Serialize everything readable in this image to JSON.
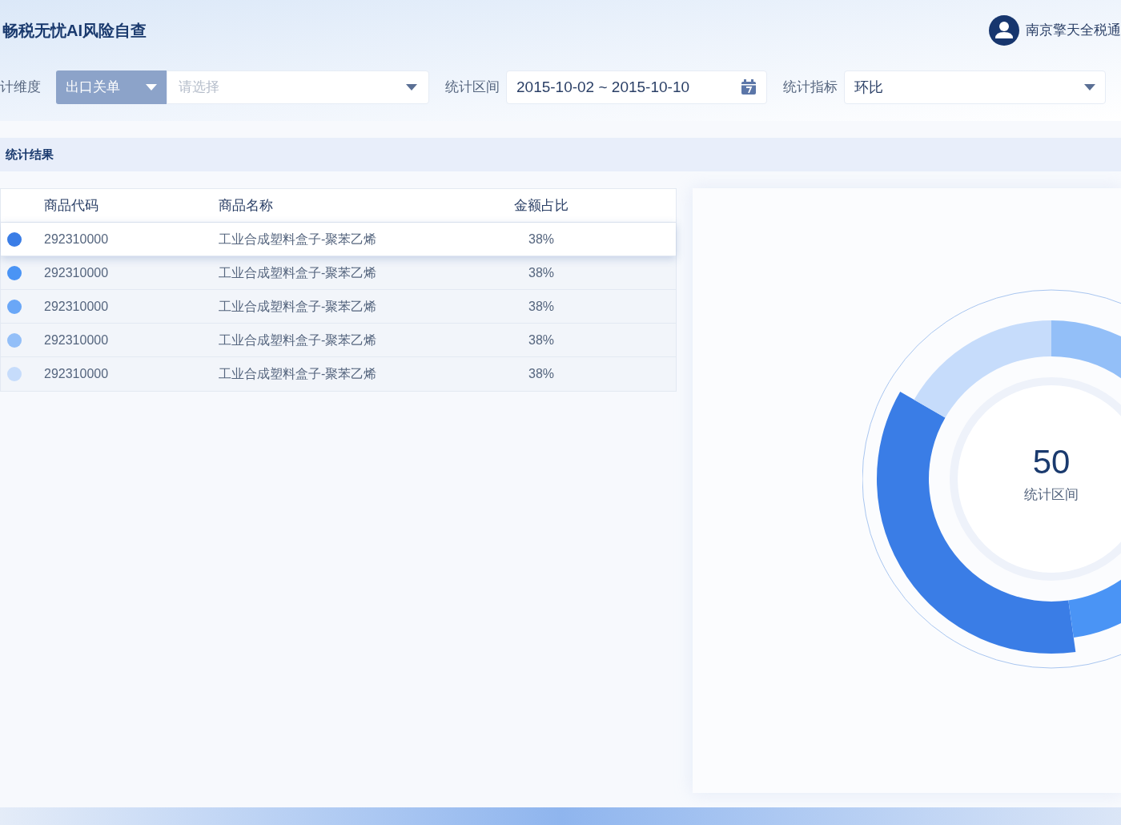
{
  "header": {
    "title": "畅税无忧AI风险自查",
    "user": "南京擎天全税通"
  },
  "filters": {
    "dimension": {
      "label": "计维度",
      "type_value": "出口关单",
      "placeholder": "请选择"
    },
    "period": {
      "label": "统计区间",
      "value": "2015-10-02 ~ 2015-10-10"
    },
    "indicator": {
      "label": "统计指标",
      "value": "环比"
    }
  },
  "results": {
    "title": "统计结果",
    "table": {
      "columns": [
        "商品代码",
        "商品名称",
        "金额占比"
      ],
      "rows": [
        {
          "color": "#3a7de6",
          "selected": true,
          "code": "292310000",
          "name": "工业合成塑料盒子-聚苯乙烯",
          "share": "38%"
        },
        {
          "color": "#4a94f5",
          "selected": false,
          "code": "292310000",
          "name": "工业合成塑料盒子-聚苯乙烯",
          "share": "38%"
        },
        {
          "color": "#6aa7f7",
          "selected": false,
          "code": "292310000",
          "name": "工业合成塑料盒子-聚苯乙烯",
          "share": "38%"
        },
        {
          "color": "#93bff8",
          "selected": false,
          "code": "292310000",
          "name": "工业合成塑料盒子-聚苯乙烯",
          "share": "38%"
        },
        {
          "color": "#c6dcfb",
          "selected": false,
          "code": "292310000",
          "name": "工业合成塑料盒子-聚苯乙烯",
          "share": "38%"
        }
      ]
    }
  },
  "donut": {
    "value": "50",
    "label": "统计区间"
  }
}
